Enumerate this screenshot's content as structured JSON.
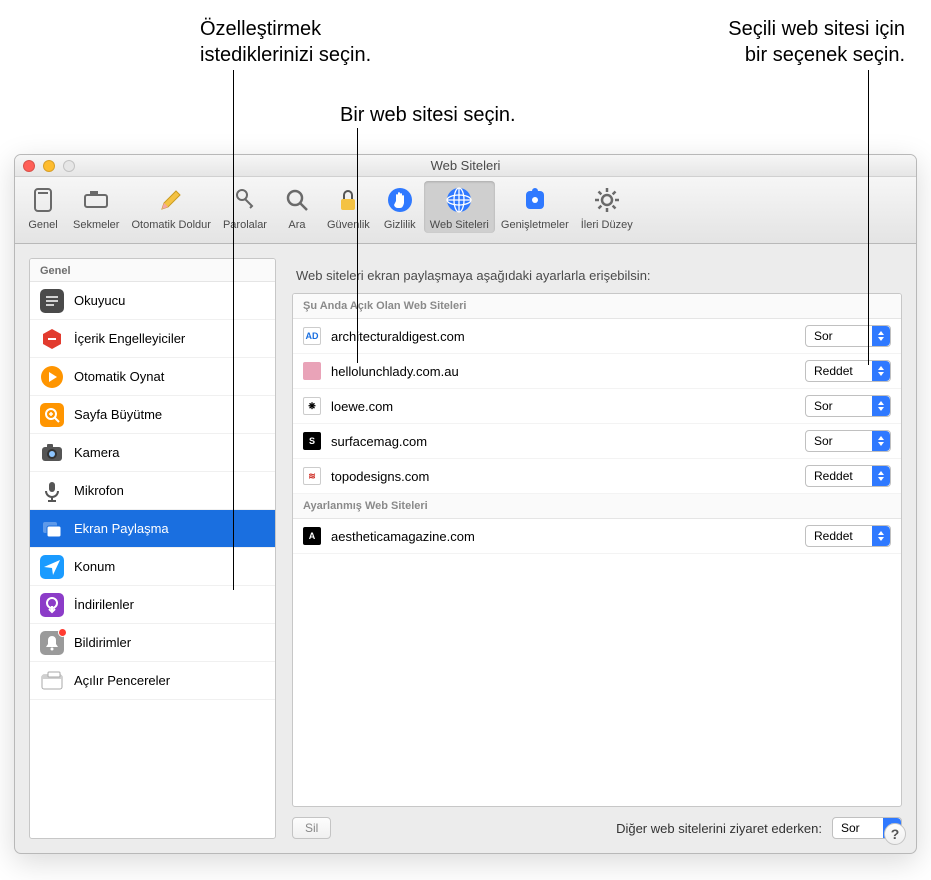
{
  "callouts": {
    "left_line1": "Özelleştirmek",
    "left_line2": "istediklerinizi seçin.",
    "mid": "Bir web sitesi seçin.",
    "right_line1": "Seçili web sitesi için",
    "right_line2": "bir seçenek seçin."
  },
  "window": {
    "title": "Web Siteleri"
  },
  "toolbar": {
    "items": [
      {
        "label": "Genel",
        "icon": "switch"
      },
      {
        "label": "Sekmeler",
        "icon": "tabs"
      },
      {
        "label": "Otomatik Doldur",
        "icon": "pencil"
      },
      {
        "label": "Parolalar",
        "icon": "key"
      },
      {
        "label": "Ara",
        "icon": "search"
      },
      {
        "label": "Güvenlik",
        "icon": "lock"
      },
      {
        "label": "Gizlilik",
        "icon": "hand"
      },
      {
        "label": "Web Siteleri",
        "icon": "globe",
        "selected": true
      },
      {
        "label": "Genişletmeler",
        "icon": "puzzle"
      },
      {
        "label": "İleri Düzey",
        "icon": "gear"
      }
    ]
  },
  "sidebar": {
    "header": "Genel",
    "items": [
      {
        "label": "Okuyucu",
        "color": "#4a4a4a"
      },
      {
        "label": "İçerik Engelleyiciler",
        "color": "#e23b2e"
      },
      {
        "label": "Otomatik Oynat",
        "color": "#ff9500"
      },
      {
        "label": "Sayfa Büyütme",
        "color": "#ff9500"
      },
      {
        "label": "Kamera",
        "color": "#8e8e8e"
      },
      {
        "label": "Mikrofon",
        "color": "#8e8e8e"
      },
      {
        "label": "Ekran Paylaşma",
        "color": "#1a6fe0",
        "selected": true
      },
      {
        "label": "Konum",
        "color": "#1a9bff"
      },
      {
        "label": "İndirilenler",
        "color": "#8c3cc8"
      },
      {
        "label": "Bildirimler",
        "color": "#8e8e8e",
        "badge": true
      },
      {
        "label": "Açılır Pencereler",
        "color": "#8e8e8e"
      }
    ]
  },
  "main": {
    "intro": "Web siteleri ekran paylaşmaya aşağıdaki ayarlarla erişebilsin:",
    "section_open": "Şu Anda Açık Olan Web Siteleri",
    "section_configured": "Ayarlanmış Web Siteleri",
    "open_sites": [
      {
        "domain": "architecturaldigest.com",
        "value": "Sor",
        "fav": "AD",
        "favbg": "#ffffff",
        "favfg": "#1a6fe0",
        "border": true
      },
      {
        "domain": "hellolunchlady.com.au",
        "value": "Reddet",
        "fav": "",
        "favbg": "#e9a3b8",
        "favfg": "#fff"
      },
      {
        "domain": "loewe.com",
        "value": "Sor",
        "fav": "❋",
        "favbg": "#ffffff",
        "favfg": "#000",
        "border": true
      },
      {
        "domain": "surfacemag.com",
        "value": "Sor",
        "fav": "S",
        "favbg": "#000000",
        "favfg": "#fff"
      },
      {
        "domain": "topodesigns.com",
        "value": "Reddet",
        "fav": "≋",
        "favbg": "#ffffff",
        "favfg": "#d0342c",
        "border": true
      }
    ],
    "configured_sites": [
      {
        "domain": "aestheticamagazine.com",
        "value": "Reddet",
        "fav": "A",
        "favbg": "#000000",
        "favfg": "#fff"
      }
    ],
    "delete_label": "Sil",
    "other_label": "Diğer web sitelerini ziyaret ederken:",
    "other_value": "Sor"
  }
}
